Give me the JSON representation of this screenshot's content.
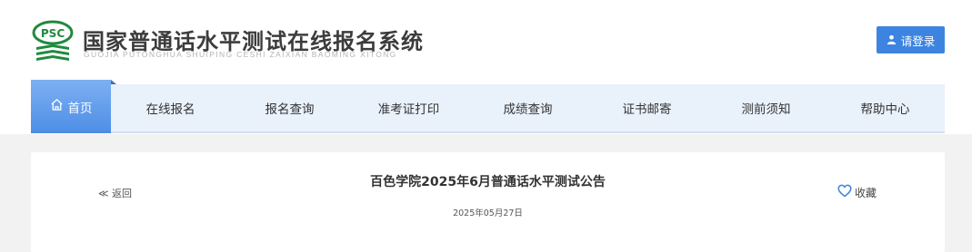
{
  "header": {
    "logo_text": "PSC",
    "site_title": "国家普通话水平测试在线报名系统",
    "site_subtitle": "GUOJIA PUTONGHUA SHUIPING CESHI ZAIXIAN BAOMING XITONG",
    "login_label": "请登录",
    "colors": {
      "accent": "#3d84e0",
      "logo_green": "#1f8a3c",
      "nav_bg": "#e9f1fb"
    }
  },
  "nav": {
    "items": [
      {
        "label": "首页",
        "icon": "home-icon",
        "active": true
      },
      {
        "label": "在线报名"
      },
      {
        "label": "报名查询"
      },
      {
        "label": "准考证打印"
      },
      {
        "label": "成绩查询"
      },
      {
        "label": "证书邮寄"
      },
      {
        "label": "测前须知"
      },
      {
        "label": "帮助中心"
      }
    ]
  },
  "article": {
    "back_label": "≪ 返回",
    "title": "百色学院2025年6月普通话水平测试公告",
    "date": "2025年05月27日",
    "favorite_label": "收藏"
  }
}
